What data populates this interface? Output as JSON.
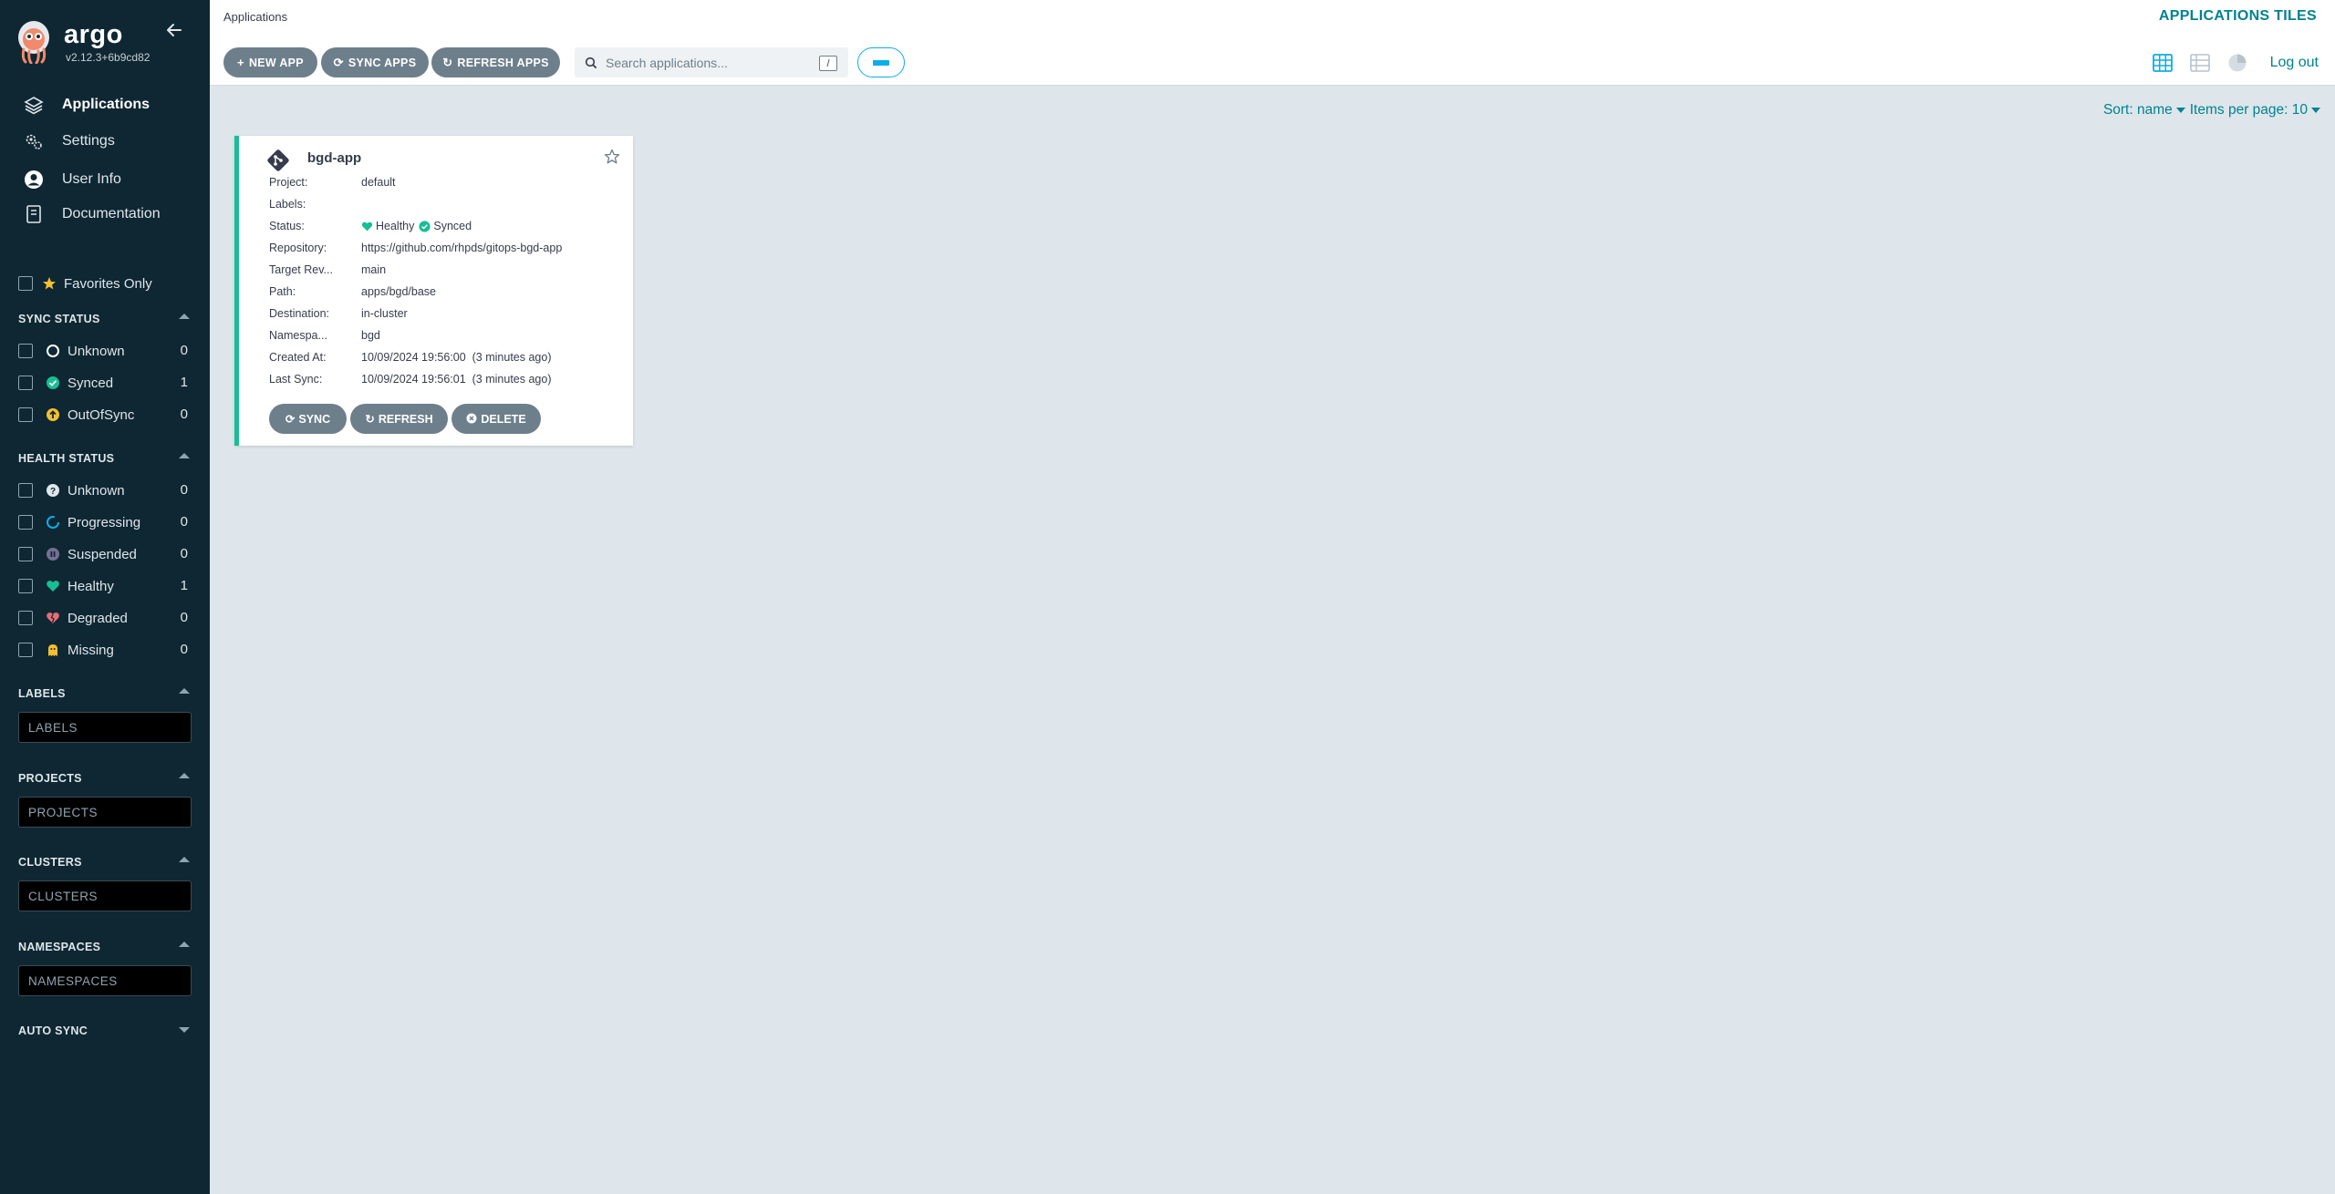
{
  "app": {
    "name": "argo",
    "version": "v2.12.3+6b9cd82"
  },
  "nav": {
    "items": [
      {
        "label": "Applications",
        "icon": "layers-icon",
        "active": true
      },
      {
        "label": "Settings",
        "icon": "gears-icon"
      },
      {
        "label": "User Info",
        "icon": "user-circle-icon"
      },
      {
        "label": "Documentation",
        "icon": "book-icon"
      }
    ]
  },
  "filters": {
    "favorites_label": "Favorites Only",
    "sync_status": {
      "title": "SYNC STATUS",
      "items": [
        {
          "label": "Unknown",
          "count": "0",
          "icon": "circle-notch-icon"
        },
        {
          "label": "Synced",
          "count": "1",
          "icon": "check-circle-icon"
        },
        {
          "label": "OutOfSync",
          "count": "0",
          "icon": "arrow-up-circle-icon"
        }
      ]
    },
    "health_status": {
      "title": "HEALTH STATUS",
      "items": [
        {
          "label": "Unknown",
          "count": "0",
          "icon": "question-circle-icon"
        },
        {
          "label": "Progressing",
          "count": "0",
          "icon": "spinner-icon"
        },
        {
          "label": "Suspended",
          "count": "0",
          "icon": "pause-circle-icon"
        },
        {
          "label": "Healthy",
          "count": "1",
          "icon": "heart-icon"
        },
        {
          "label": "Degraded",
          "count": "0",
          "icon": "heart-broken-icon"
        },
        {
          "label": "Missing",
          "count": "0",
          "icon": "ghost-icon"
        }
      ]
    },
    "labels": {
      "title": "LABELS",
      "placeholder": "LABELS"
    },
    "projects": {
      "title": "PROJECTS",
      "placeholder": "PROJECTS"
    },
    "clusters": {
      "title": "CLUSTERS",
      "placeholder": "CLUSTERS"
    },
    "namespaces": {
      "title": "NAMESPACES",
      "placeholder": "NAMESPACES"
    },
    "auto_sync": {
      "title": "AUTO SYNC"
    }
  },
  "header": {
    "breadcrumb": "Applications",
    "page_title": "APPLICATIONS TILES",
    "buttons": {
      "new_app": "NEW APP",
      "sync_apps": "SYNC APPS",
      "refresh_apps": "REFRESH APPS"
    },
    "search": {
      "placeholder": "Search applications...",
      "shortcut": "/"
    },
    "logout": "Log out"
  },
  "list_controls": {
    "sort": "Sort: name",
    "per_page": "Items per page: 10"
  },
  "applications": [
    {
      "name": "bgd-app",
      "rows": [
        {
          "label": "Project:",
          "value": "default"
        },
        {
          "label": "Labels:",
          "value": ""
        },
        {
          "label": "Status:",
          "health": "Healthy",
          "sync": "Synced"
        },
        {
          "label": "Repository:",
          "value": "https://github.com/rhpds/gitops-bgd-app"
        },
        {
          "label": "Target Rev...",
          "value": "main"
        },
        {
          "label": "Path:",
          "value": "apps/bgd/base"
        },
        {
          "label": "Destination:",
          "value": "in-cluster"
        },
        {
          "label": "Namespa...",
          "value": "bgd"
        },
        {
          "label": "Created At:",
          "value": "10/09/2024 19:56:00  (3 minutes ago)"
        },
        {
          "label": "Last Sync:",
          "value": "10/09/2024 19:56:01  (3 minutes ago)"
        }
      ],
      "actions": {
        "sync": "SYNC",
        "refresh": "REFRESH",
        "delete": "DELETE"
      }
    }
  ],
  "colors": {
    "sidebar_bg": "#0f2733",
    "accent": "#00828f",
    "healthy": "#18be94",
    "synced": "#18be94",
    "out_of_sync": "#f4c030",
    "degraded": "#e96d76",
    "suspended": "#766f94",
    "progressing": "#0dadea",
    "button_gray": "#6d7f8b"
  }
}
